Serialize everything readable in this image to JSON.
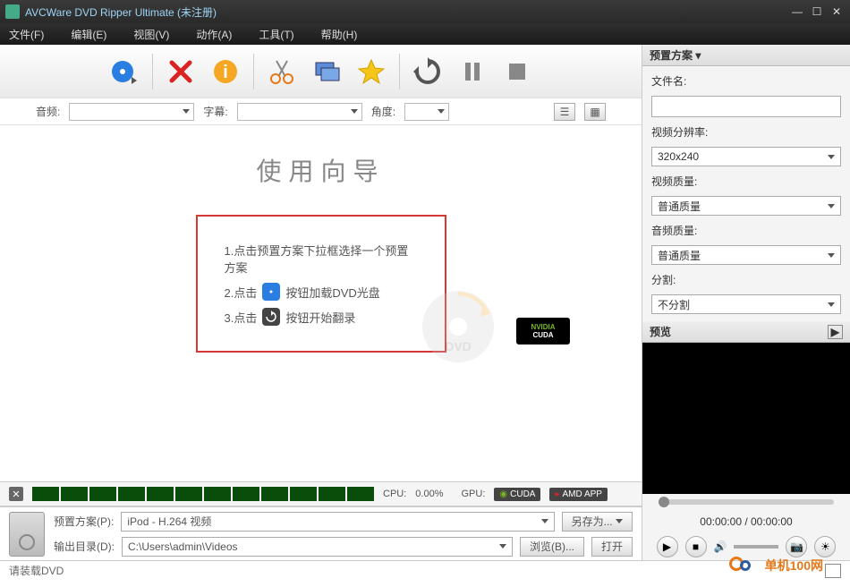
{
  "title": "AVCWare DVD Ripper Ultimate (未注册)",
  "menu": {
    "file": "文件(F)",
    "edit": "编辑(E)",
    "view": "视图(V)",
    "action": "动作(A)",
    "tools": "工具(T)",
    "help": "帮助(H)"
  },
  "filterbar": {
    "audio": "音频:",
    "subtitle": "字幕:",
    "angle": "角度:"
  },
  "wizard": {
    "title": "使用向导",
    "step1": "1.点击预置方案下拉框选择一个预置方案",
    "step2_pre": "2.点击",
    "step2_post": "按钮加载DVD光盘",
    "step3_pre": "3.点击",
    "step3_post": "按钮开始翻录"
  },
  "cuda": {
    "brand": "NVIDIA",
    "name": "CUDA"
  },
  "cpu": {
    "label": "CPU:",
    "value": "0.00%",
    "gpu_label": "GPU:",
    "cuda": "CUDA",
    "amd": "AMD APP"
  },
  "preset": {
    "label": "预置方案(P):",
    "value": "iPod - H.264 视频",
    "saveas": "另存为...",
    "output_label": "输出目录(D):",
    "output_value": "C:\\Users\\admin\\Videos",
    "browse": "浏览(B)...",
    "open": "打开"
  },
  "status": "请装载DVD",
  "right": {
    "preset_header": "预置方案",
    "filename": "文件名:",
    "resolution": "视频分辨率:",
    "resolution_val": "320x240",
    "vquality": "视频质量:",
    "vquality_val": "普通质量",
    "aquality": "音频质量:",
    "aquality_val": "普通质量",
    "split": "分割:",
    "split_val": "不分割",
    "preview": "预览",
    "time": "00:00:00 / 00:00:00"
  },
  "watermark": "单机100网"
}
